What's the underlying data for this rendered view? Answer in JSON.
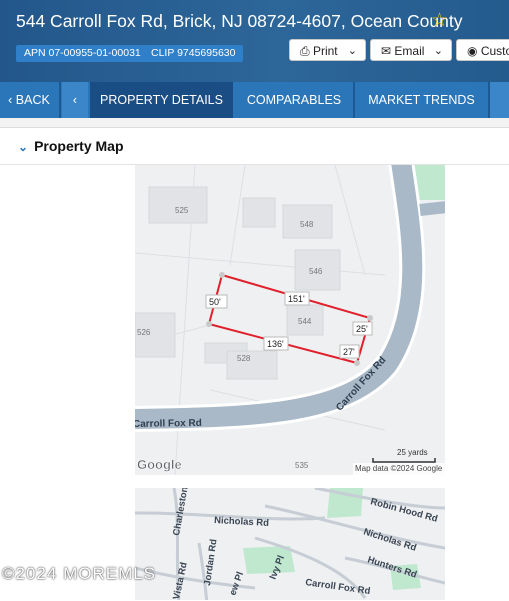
{
  "header": {
    "address": "544 Carroll Fox Rd, Brick, NJ 08724-4607, Ocean County",
    "apn": "APN 07-00955-01-00031",
    "clip": "CLIP 9745695630",
    "buttons": {
      "print": "Print",
      "email": "Email",
      "custom": "Custom"
    }
  },
  "tabs": {
    "back": "BACK",
    "details": "PROPERTY DETAILS",
    "comparables": "COMPARABLES",
    "trends": "MARKET TRENDS"
  },
  "panel": {
    "title": "Property Map"
  },
  "map": {
    "lots": [
      "525",
      "548",
      "546",
      "526",
      "544",
      "528",
      "535"
    ],
    "dims": {
      "top": "151'",
      "left": "50'",
      "right": "25'",
      "bottom": "136'",
      "corner": "27'"
    },
    "road": "Carroll Fox Rd",
    "road_curve": "Carroll Fox Rd",
    "scale": "25 yards",
    "google": "Google",
    "attribution": "Map data ©2024 Google"
  },
  "map2": {
    "streets": [
      "Charleston Rd",
      "Nicholas Rd",
      "Nicholas Rd",
      "Robin Hood Rd",
      "Hunters Rd",
      "Jordan Rd",
      "Ivy Pl",
      "Carroll Fox Rd",
      "Vista Rd",
      "ew Pl"
    ]
  },
  "watermark": "©2024 MOREMLS",
  "colors": {
    "header": "#2a5a8c",
    "tab_bar": "#2b76b9",
    "tab_active": "#1a4d84",
    "parcel": "#e0202a",
    "road": "#a9b9c8",
    "park": "#bfe8cf"
  }
}
